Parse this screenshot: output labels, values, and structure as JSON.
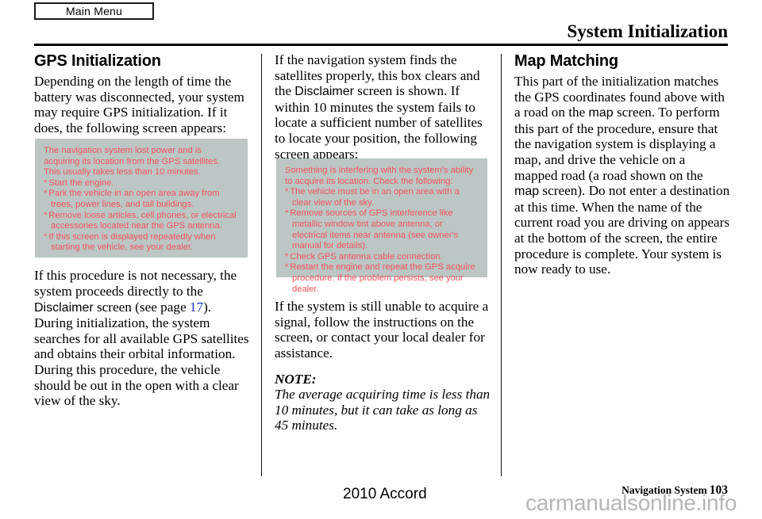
{
  "header": {
    "tab_label": "Main Menu",
    "title": "System Initialization"
  },
  "columns": {
    "left": {
      "heading": "GPS Initialization",
      "intro": "Depending on the length of time the battery was disconnected, your system may require GPS initialization. If it does, the following screen appears:",
      "after_1": "If this procedure is not necessary, the system proceeds directly to the ",
      "after_term": "Disclaimer",
      "after_2": " screen (see page ",
      "after_pagelink": "17",
      "after_3": ").",
      "after_4": "During initialization, the system searches for all available GPS satellites and obtains their orbital information. During this procedure, the vehicle should be out in the open with a clear view of the sky."
    },
    "middle": {
      "intro_1": "If the navigation system finds the satellites properly, this box clears and the ",
      "intro_term": "Disclaimer",
      "intro_2": " screen is shown. If within 10 minutes the system fails to locate a sufficient number of satellites to locate your position, the following screen appears:",
      "after_box": "If the system is still unable to acquire a signal, follow the instructions on the screen, or contact your local dealer for assistance.",
      "note_label": "NOTE:",
      "note_body": "The average acquiring time is less than 10 minutes, but it can take as long as 45 minutes."
    },
    "right": {
      "heading": "Map Matching",
      "para_1": "This part of the initialization matches the GPS coordinates found above with a road on the ",
      "term_1": "map",
      "para_2": " screen. To perform this part of the procedure, ensure that the navigation system is displaying a map, and drive the vehicle on a mapped road (a road shown on the ",
      "term_2": "map",
      "para_3": " screen). Do not enter a destination at this time. When the name of the current road you are driving on appears at the bottom of the screen, the entire procedure is complete. Your system is now ready to use."
    }
  },
  "device_screens": {
    "gps_acquiring": {
      "intro": "The navigation system lost power and is acquiring its location from the GPS satellites. This usually takes less than 10 minutes.",
      "bullets": [
        "Start the engine.",
        "Park the vehicle in an open area away from trees, power lines, and tall buildings.",
        "Remove loose articles, cell phones, or electrical accessories located near the GPS antenna.",
        "If this screen is displayed repeatedly when starting the vehicle, see your dealer."
      ],
      "bullet_marker": "*"
    },
    "gps_interference": {
      "intro": "Something is interfering with the system's ability to acquire its location. Check the following:",
      "bullets": [
        "The vehicle must be in an open area with a clear view of the sky.",
        "Remove sources of GPS interference like metallic window tint above antenna, or electrical items near antenna (see owner's manual for details).",
        "Check GPS antenna cable connection.",
        "Restart the engine and repeat the GPS acquire procedure. If the problem persists, see your dealer."
      ],
      "bullet_marker": "*"
    }
  },
  "footer": {
    "model": "2010 Accord",
    "section": "Navigation System",
    "page_number": "103",
    "watermark": "carmanualsonline.info"
  },
  "colors": {
    "screen_background": "#bcc6c4",
    "screen_text": "#f2545b",
    "page_link": "#2030c8",
    "watermark": "#b6b6b6"
  }
}
